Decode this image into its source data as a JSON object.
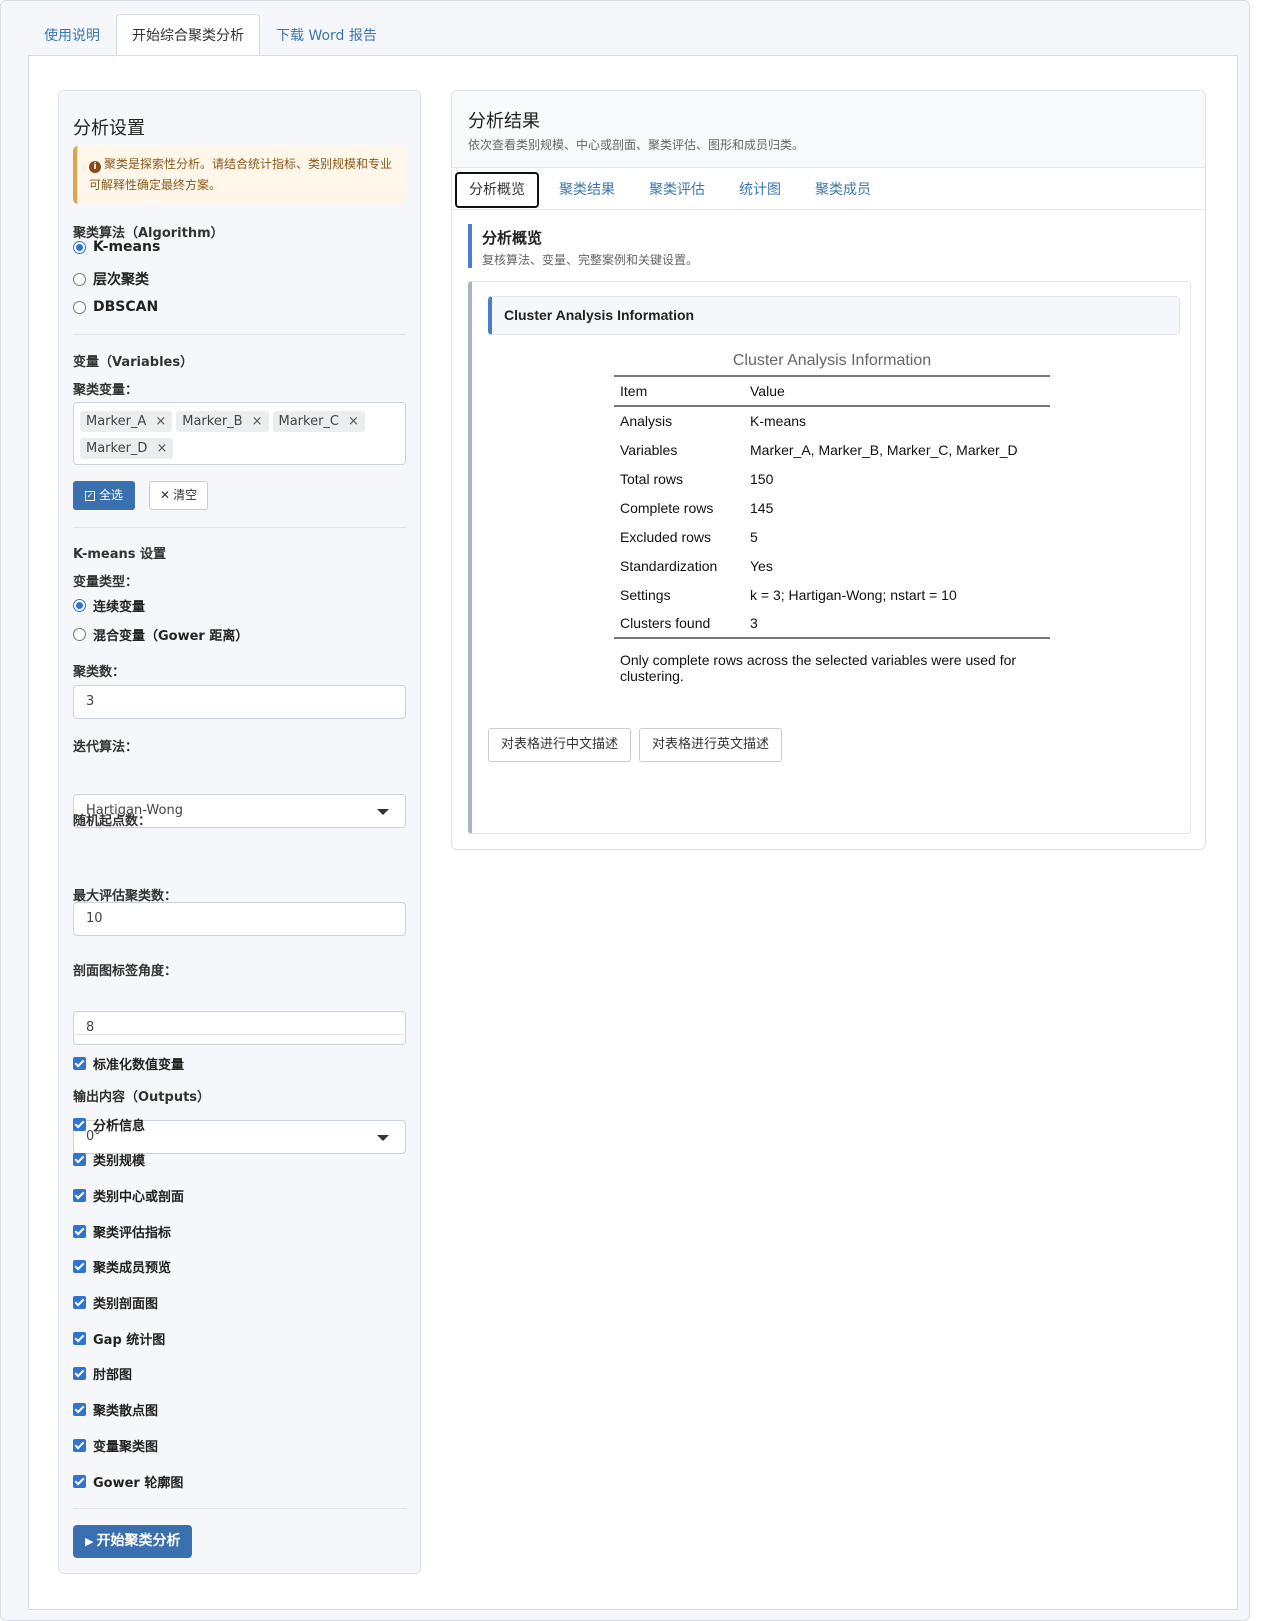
{
  "top_tabs": [
    "使用说明",
    "开始综合聚类分析",
    "下载 Word 报告"
  ],
  "left": {
    "title": "分析设置",
    "alert": "聚类是探索性分析。请结合统计指标、类别规模和专业可解释性确定最终方案。",
    "algorithm": {
      "label": "聚类算法（Algorithm）",
      "options": [
        "K-means",
        "层次聚类",
        "DBSCAN"
      ],
      "selected": "K-means"
    },
    "variables": {
      "label": "变量（Variables）",
      "field_label": "聚类变量：",
      "selected": [
        "Marker_A",
        "Marker_B",
        "Marker_C",
        "Marker_D"
      ],
      "select_all": "全选",
      "clear": "清空"
    },
    "kmeans": {
      "label": "K-means 设置",
      "var_type_label": "变量类型：",
      "var_types": [
        "连续变量",
        "混合变量（Gower 距离）"
      ],
      "var_type_selected": "连续变量",
      "k_label": "聚类数：",
      "k_value": "3",
      "algo_label": "迭代算法：",
      "algo_value": "Hartigan-Wong",
      "nstart_label": "随机起点数：",
      "nstart_value": "10",
      "maxk_label": "最大评估聚类数：",
      "maxk_value": "8",
      "angle_label": "剖面图标签角度：",
      "angle_value": "0°"
    },
    "standardize": "标准化数值变量",
    "outputs_label": "输出内容（Outputs）",
    "outputs": [
      "分析信息",
      "类别规模",
      "类别中心或剖面",
      "聚类评估指标",
      "聚类成员预览",
      "类别剖面图",
      "Gap 统计图",
      "肘部图",
      "聚类散点图",
      "变量聚类图",
      "Gower 轮廓图"
    ],
    "run_button": "开始聚类分析"
  },
  "right": {
    "title": "分析结果",
    "subtitle": "依次查看类别规模、中心或剖面、聚类评估、图形和成员归类。",
    "tabs": [
      "分析概览",
      "聚类结果",
      "聚类评估",
      "统计图",
      "聚类成员"
    ],
    "overview_title": "分析概览",
    "overview_subtitle": "复核算法、变量、完整案例和关键设置。",
    "card_title": "Cluster Analysis Information",
    "table": {
      "caption": "Cluster Analysis Information",
      "headers": [
        "Item",
        "Value"
      ],
      "rows": [
        [
          "Analysis",
          "K-means"
        ],
        [
          "Variables",
          "Marker_A, Marker_B, Marker_C, Marker_D"
        ],
        [
          "Total rows",
          "150"
        ],
        [
          "Complete rows",
          "145"
        ],
        [
          "Excluded rows",
          "5"
        ],
        [
          "Standardization",
          "Yes"
        ],
        [
          "Settings",
          "k = 3; Hartigan-Wong; nstart = 10"
        ],
        [
          "Clusters found",
          "3"
        ]
      ],
      "note": "Only complete rows across the selected variables were used for clustering."
    },
    "btn_zh": "对表格进行中文描述",
    "btn_en": "对表格进行英文描述"
  }
}
